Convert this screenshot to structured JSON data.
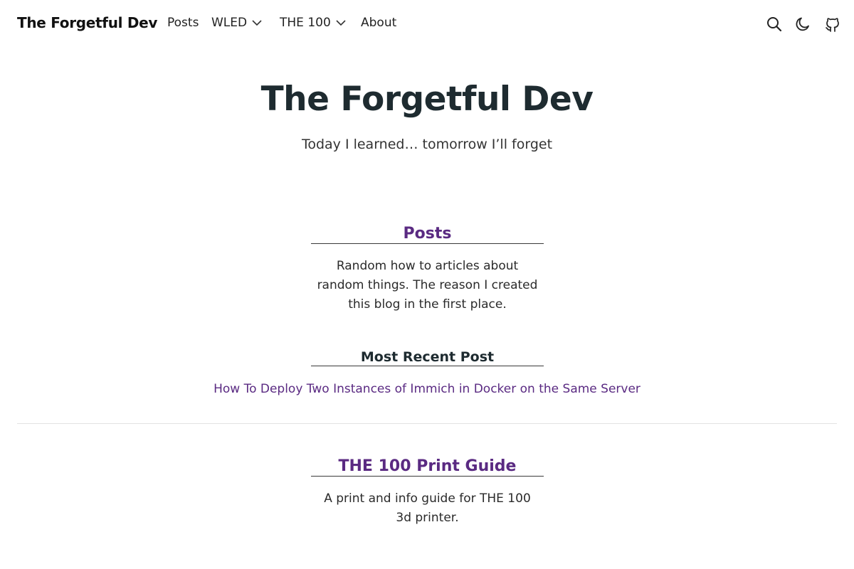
{
  "header": {
    "brand": "The Forgetful Dev",
    "nav": {
      "posts": "Posts",
      "wled": "WLED",
      "the100": "THE 100",
      "about": "About"
    }
  },
  "hero": {
    "title": "The Forgetful Dev",
    "subtitle": "Today I learned… tomorrow I’ll forget"
  },
  "posts_section": {
    "heading": "Posts",
    "description": "Random how to articles about random things. The reason I created this blog in the first place."
  },
  "recent": {
    "heading": "Most Recent Post",
    "link": "How To Deploy Two Instances of Immich in Docker on the Same Server"
  },
  "print_guide": {
    "heading": "THE 100 Print Guide",
    "description": "A print and info guide for THE 100 3d printer."
  },
  "colors": {
    "accent": "#5a2a82",
    "text": "#1e2b30"
  },
  "icons": [
    "search-icon",
    "moon-icon",
    "github-icon",
    "chevron-down-icon"
  ]
}
